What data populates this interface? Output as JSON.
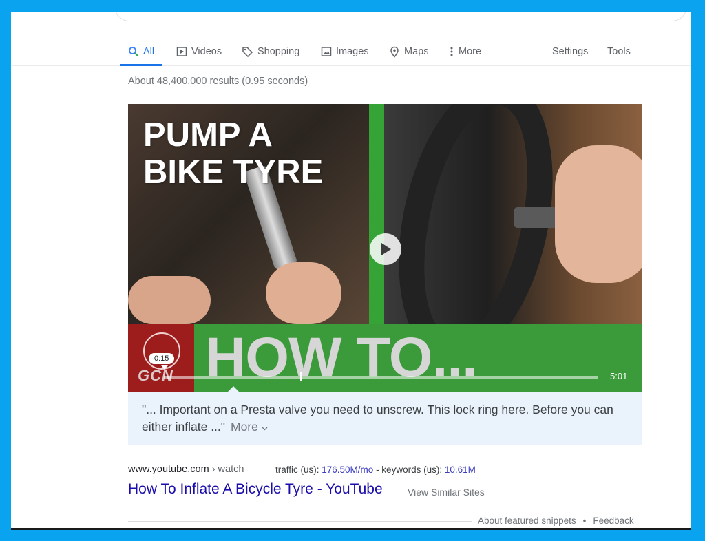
{
  "nav": {
    "tabs": [
      {
        "label": "All",
        "icon": "search-icon"
      },
      {
        "label": "Videos",
        "icon": "play-box-icon"
      },
      {
        "label": "Shopping",
        "icon": "tag-icon"
      },
      {
        "label": "Images",
        "icon": "image-icon"
      },
      {
        "label": "Maps",
        "icon": "map-pin-icon"
      },
      {
        "label": "More",
        "icon": "dots-vertical-icon"
      }
    ],
    "settings": "Settings",
    "tools": "Tools",
    "active_color": "#1a73e8"
  },
  "result_stats": "About 48,400,000 results (0.95 seconds)",
  "video": {
    "thumbnail_title_line1": "PUMP A",
    "thumbnail_title_line2": "BIKE TYRE",
    "thumbnail_banner": "HOW TO...",
    "channel_logo_text": "GCN",
    "timestamp": "0:15",
    "duration": "5:01",
    "progress": 0.0
  },
  "caption": {
    "text": "\"... Important on a Presta valve you need to unscrew. This lock ring here. Before you can either inflate ...\"",
    "more": "More"
  },
  "result": {
    "site": "www.youtube.com",
    "crumb": " › watch",
    "traffic_label": "traffic (us): ",
    "traffic_value": "176.50M/mo",
    "keywords_label": " - keywords (us): ",
    "keywords_value": "10.61M",
    "title": "How To Inflate A Bicycle Tyre - YouTube",
    "similar": "View Similar Sites"
  },
  "footer": {
    "about": "About featured snippets",
    "separator": "•",
    "feedback": "Feedback"
  }
}
